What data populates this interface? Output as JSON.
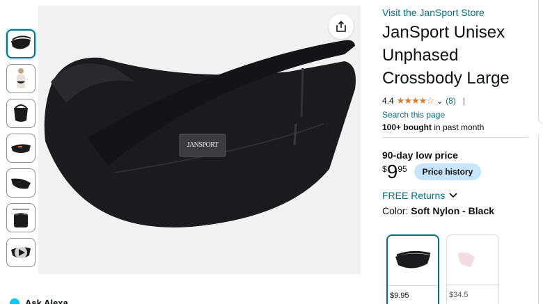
{
  "product": {
    "store_link": "Visit the JanSport Store",
    "title": "JanSport Unisex Unphased Crossbody Large",
    "rating": "4.4",
    "stars": "★★★★☆",
    "rating_count": "(8)",
    "separator": "|",
    "search_page": "Search this page",
    "bought_bold": "100+ bought",
    "bought_rest": "in past month",
    "low_price_label": "90-day low price",
    "price_symbol": "$",
    "price_whole": "9",
    "price_cents": "95",
    "price_history_label": "Price history",
    "returns_label": "FREE Returns",
    "color_label": "Color:",
    "color_value": "Soft Nylon - Black",
    "swatches": [
      {
        "price": "$9.95"
      },
      {
        "price": "$34.5"
      }
    ],
    "brand_patch": "JANSPORT"
  },
  "media": {
    "thumbnails": [
      "bag-thumb",
      "model-thumb",
      "bag-side-thumb",
      "bag-open-thumb",
      "bag-angle-thumb",
      "bag-size-thumb",
      "video-thumb"
    ],
    "share_icon": "share-icon"
  },
  "alexa": {
    "label": "Ask Alexa"
  },
  "colors": {
    "link": "#007185",
    "star": "#de7921",
    "price_history_bg": "#c7e6fd",
    "bag": "#1b1b1d"
  }
}
